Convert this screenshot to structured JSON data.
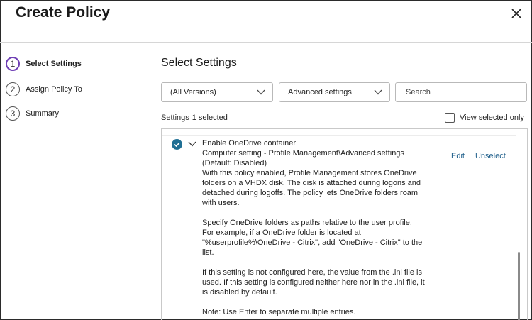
{
  "dialog": {
    "title": "Create Policy"
  },
  "steps": [
    {
      "number": "1",
      "label": "Select Settings",
      "active": true
    },
    {
      "number": "2",
      "label": "Assign Policy To",
      "active": false
    },
    {
      "number": "3",
      "label": "Summary",
      "active": false
    }
  ],
  "main": {
    "title": "Select Settings",
    "version_select": "(All Versions)",
    "category_select": "Advanced settings",
    "search_placeholder": "Search",
    "settings_label": "Settings",
    "selected_count": "1 selected",
    "view_selected_only": "View selected only"
  },
  "setting_item": {
    "name": "Enable OneDrive container",
    "path": "Computer setting - Profile Management\\Advanced settings",
    "default": "(Default: Disabled)",
    "para1": "With this policy enabled, Profile Management stores OneDrive folders on a VHDX disk. The disk is attached during logons and detached during logoffs. The policy lets OneDrive folders roam with users.",
    "para2": "Specify OneDrive folders as paths relative to the user profile. For example, if a OneDrive folder is located at \"%userprofile%\\OneDrive - Citrix\", add \"OneDrive - Citrix\" to the list.",
    "para3": "If this setting is not configured here, the value from the .ini file is used. If this setting is configured neither here nor in the .ini file, it is disabled by default.",
    "para4": "Note: Use Enter to separate multiple entries.",
    "edit": "Edit",
    "unselect": "Unselect",
    "selected": true
  },
  "colors": {
    "accent_purple": "#6f3fb5",
    "check_teal": "#1f6f94",
    "link_blue": "#1f5f8b"
  },
  "icons": [
    "close-icon",
    "chevron-down-icon",
    "check-circle-icon",
    "expand-chevron-icon"
  ]
}
